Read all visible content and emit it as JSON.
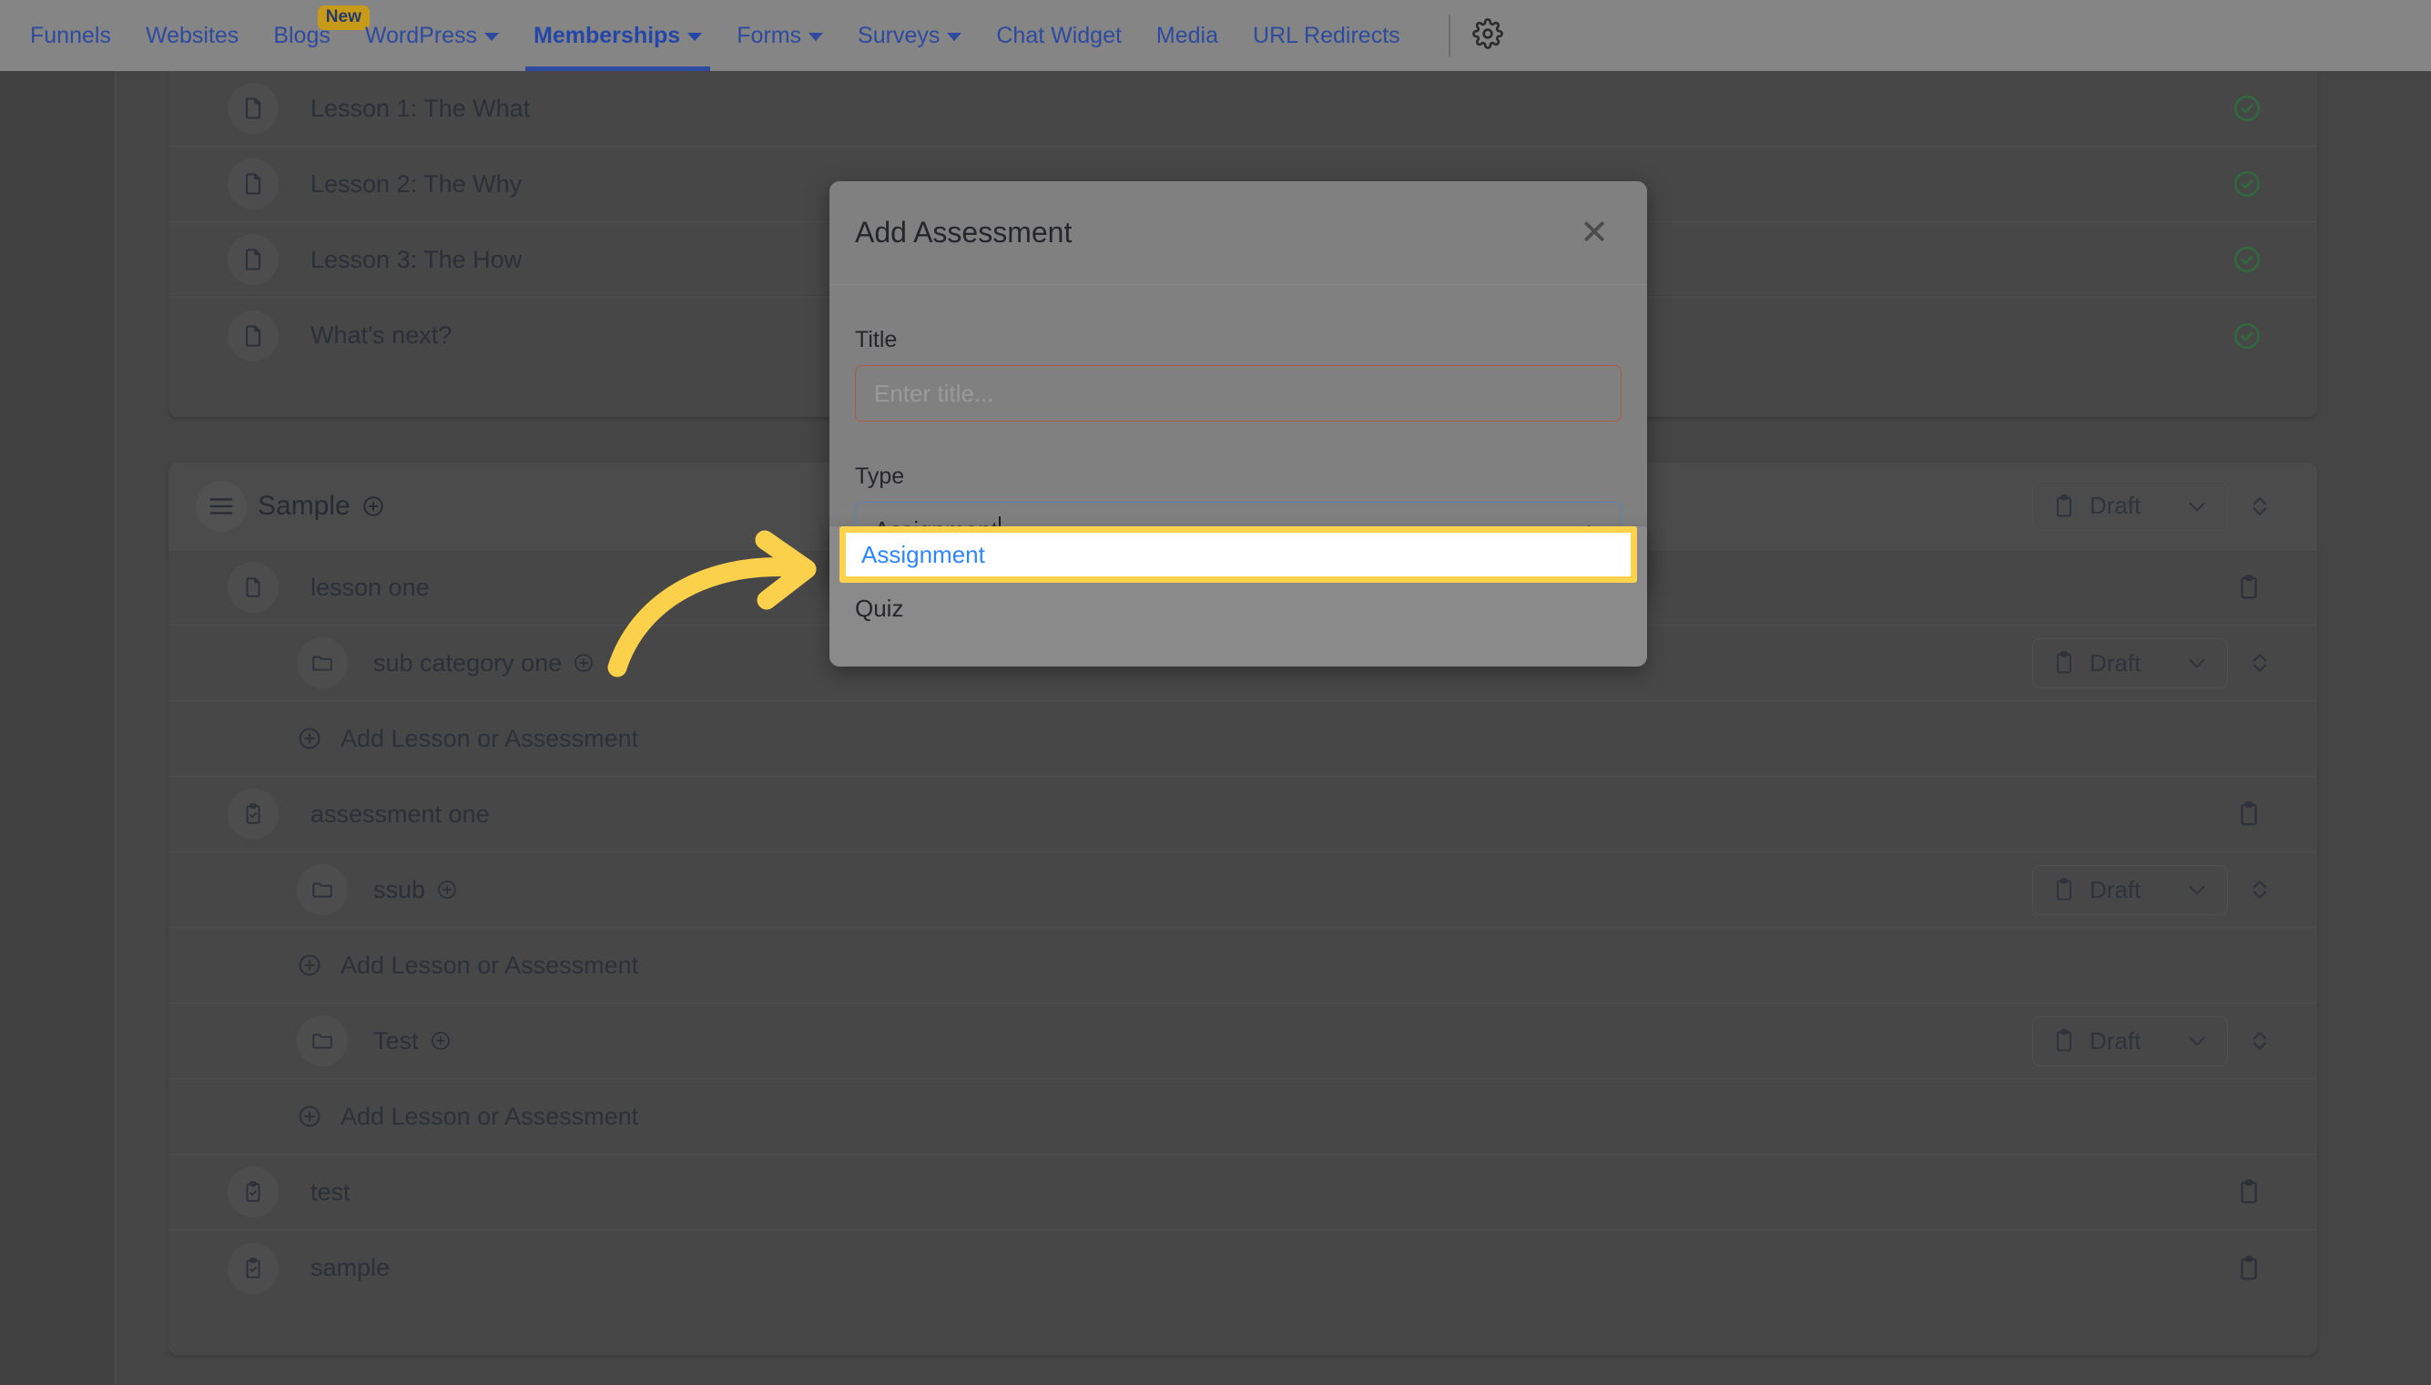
{
  "topnav": {
    "items": [
      {
        "label": "Funnels",
        "icon": "",
        "has_caret": false,
        "active": false,
        "badge": ""
      },
      {
        "label": "Websites",
        "icon": "",
        "has_caret": false,
        "active": false,
        "badge": ""
      },
      {
        "label": "Blogs",
        "icon": "",
        "has_caret": false,
        "active": false,
        "badge": "New"
      },
      {
        "label": "WordPress",
        "icon": "chevron-down-icon",
        "has_caret": true,
        "active": false,
        "badge": ""
      },
      {
        "label": "Memberships",
        "icon": "chevron-down-icon",
        "has_caret": true,
        "active": true,
        "badge": ""
      },
      {
        "label": "Forms",
        "icon": "chevron-down-icon",
        "has_caret": true,
        "active": false,
        "badge": ""
      },
      {
        "label": "Surveys",
        "icon": "chevron-down-icon",
        "has_caret": true,
        "active": false,
        "badge": ""
      },
      {
        "label": "Chat Widget",
        "icon": "",
        "has_caret": false,
        "active": false,
        "badge": ""
      },
      {
        "label": "Media",
        "icon": "",
        "has_caret": false,
        "active": false,
        "badge": ""
      },
      {
        "label": "URL Redirects",
        "icon": "",
        "has_caret": false,
        "active": false,
        "badge": ""
      }
    ],
    "settings_icon": "gear-icon",
    "link_color": "#2d4a9e",
    "bar_color": "#858585",
    "badge_color": "#c79b17"
  },
  "card_top": {
    "rows": [
      {
        "icon": "document-icon",
        "label": "Lesson 1: The What",
        "status_icon": "check-circle-icon"
      },
      {
        "icon": "document-icon",
        "label": "Lesson 2: The Why",
        "status_icon": "check-circle-icon"
      },
      {
        "icon": "document-icon",
        "label": "Lesson 3: The How",
        "status_icon": "check-circle-icon"
      },
      {
        "icon": "document-icon",
        "label": "What's next?",
        "status_icon": "check-circle-icon"
      }
    ],
    "status_color": "#2f6b3d"
  },
  "card_main": {
    "section": {
      "drag_icon": "drag-handle-icon",
      "title": "Sample",
      "add_icon": "plus-circle-icon",
      "status_label": "Draft",
      "status_icon": "clipboard-icon",
      "chevron_icon": "chevron-down-icon",
      "sort_icon": "sort-updown-icon"
    },
    "rows": [
      {
        "kind": "lesson",
        "indent": 0,
        "icon": "document-icon",
        "label": "lesson one",
        "add_icon": "",
        "trail_icon": "clipboard-icon",
        "status_label": "",
        "has_status_chip": false,
        "has_sort": false
      },
      {
        "kind": "folder",
        "indent": 1,
        "icon": "folder-icon",
        "label": "sub category one",
        "add_icon": "plus-circle-icon",
        "trail_icon": "",
        "status_label": "Draft",
        "has_status_chip": true,
        "has_sort": true
      },
      {
        "kind": "add",
        "indent": 1,
        "icon": "plus-circle-icon",
        "label": "Add Lesson or Assessment",
        "add_icon": "",
        "trail_icon": "",
        "status_label": "",
        "has_status_chip": false,
        "has_sort": false
      },
      {
        "kind": "assess",
        "indent": 0,
        "icon": "clipboard-check-icon",
        "label": "assessment one",
        "add_icon": "",
        "trail_icon": "clipboard-icon",
        "status_label": "",
        "has_status_chip": false,
        "has_sort": false
      },
      {
        "kind": "folder",
        "indent": 1,
        "icon": "folder-icon",
        "label": "ssub",
        "add_icon": "plus-circle-icon",
        "trail_icon": "",
        "status_label": "Draft",
        "has_status_chip": true,
        "has_sort": true
      },
      {
        "kind": "add",
        "indent": 1,
        "icon": "plus-circle-icon",
        "label": "Add Lesson or Assessment",
        "add_icon": "",
        "trail_icon": "",
        "status_label": "",
        "has_status_chip": false,
        "has_sort": false
      },
      {
        "kind": "folder",
        "indent": 1,
        "icon": "folder-icon",
        "label": "Test",
        "add_icon": "plus-circle-icon",
        "trail_icon": "",
        "status_label": "Draft",
        "has_status_chip": true,
        "has_sort": true
      },
      {
        "kind": "add",
        "indent": 1,
        "icon": "plus-circle-icon",
        "label": "Add Lesson or Assessment",
        "add_icon": "",
        "trail_icon": "",
        "status_label": "",
        "has_status_chip": false,
        "has_sort": false
      },
      {
        "kind": "assess",
        "indent": 0,
        "icon": "clipboard-check-icon",
        "label": "test",
        "add_icon": "",
        "trail_icon": "clipboard-icon",
        "status_label": "",
        "has_status_chip": false,
        "has_sort": false
      },
      {
        "kind": "assess",
        "indent": 0,
        "icon": "clipboard-check-icon",
        "label": "sample",
        "add_icon": "",
        "trail_icon": "clipboard-icon",
        "status_label": "",
        "has_status_chip": false,
        "has_sort": false
      }
    ]
  },
  "modal": {
    "title": "Add Assessment",
    "close_icon": "close-icon",
    "title_field": {
      "label": "Title",
      "value": "",
      "placeholder": "Enter title...",
      "border_color": "#a85a4a"
    },
    "type_field": {
      "label": "Type",
      "value": "Assignment",
      "caret_icon": "chevron-up-icon",
      "border_color": "#5d82b5",
      "expanded": true,
      "options": [
        {
          "label": "Assignment",
          "highlighted": true
        },
        {
          "label": "Quiz",
          "highlighted": false
        }
      ]
    },
    "highlight_color": "#ffd24d",
    "option_selected_text_color": "#2e86ff"
  },
  "annotation": {
    "arrow_icon": "curved-arrow-right-icon",
    "arrow_color": "#fbd14b"
  }
}
